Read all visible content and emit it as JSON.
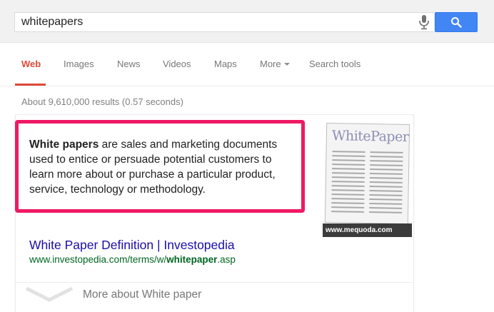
{
  "search": {
    "query": "whitepapers"
  },
  "tabs": [
    {
      "label": "Web"
    },
    {
      "label": "Images"
    },
    {
      "label": "News"
    },
    {
      "label": "Videos"
    },
    {
      "label": "Maps"
    },
    {
      "label": "More"
    },
    {
      "label": "Search tools"
    }
  ],
  "stats": "About 9,610,000 results (0.57 seconds)",
  "snippet": {
    "bold": "White papers",
    "text": " are sales and marketing documents used to entice or persuade potential customers to learn more about or purchase a particular product, service, technology or methodology."
  },
  "image": {
    "title": "WhitePaper",
    "caption": "www.mequoda.com"
  },
  "result": {
    "title": "White Paper Definition | Investopedia",
    "url_prefix": "www.investopedia.com/terms/w/",
    "url_bold": "whitepaper",
    "url_suffix": ".asp"
  },
  "more_about": "More about White paper",
  "colors": {
    "accent_red": "#dd4b39",
    "highlight_pink": "#ee1a63",
    "link_blue": "#1a0dab",
    "url_green": "#006621",
    "search_blue": "#4285f4"
  }
}
